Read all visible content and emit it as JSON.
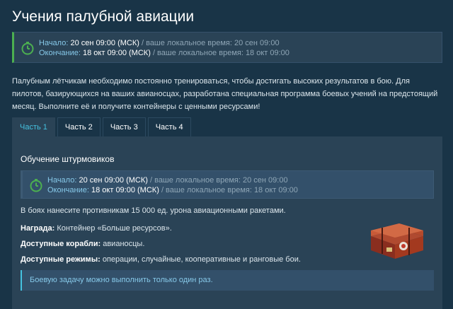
{
  "page_title": "Учения палубной авиации",
  "event_time": {
    "start_label": "Начало:",
    "start_value": "20 сен 09:00 (МСК)",
    "start_local": "/ ваше локальное время: 20 сен 09:00",
    "end_label": "Окончание:",
    "end_value": "18 окт 09:00 (МСК)",
    "end_local": "/ ваше локальное время: 18 окт 09:00"
  },
  "description": "Палубным лётчикам необходимо постоянно тренироваться, чтобы достигать высоких результатов в бою. Для пилотов, базирующихся на ваших авианосцах, разработана специальная программа боевых учений на предстоящий месяц. Выполните её и получите контейнеры с ценными ресурсами!",
  "tabs": [
    {
      "label": "Часть 1",
      "active": true
    },
    {
      "label": "Часть 2",
      "active": false
    },
    {
      "label": "Часть 3",
      "active": false
    },
    {
      "label": "Часть 4",
      "active": false
    }
  ],
  "part": {
    "title": "Обучение штурмовиков",
    "time": {
      "start_label": "Начало:",
      "start_value": "20 сен 09:00 (МСК)",
      "start_local": "/ ваше локальное время: 20 сен 09:00",
      "end_label": "Окончание:",
      "end_value": "18 окт 09:00 (МСК)",
      "end_local": "/ ваше локальное время: 18 окт 09:00"
    },
    "task": "В боях нанесите противникам 15 000 ед. урона авиационными ракетами.",
    "reward_label": "Награда:",
    "reward_value": "Контейнер «Больше ресурсов».",
    "ships_label": "Доступные корабли:",
    "ships_value": "авианосцы.",
    "modes_label": "Доступные режимы:",
    "modes_value": "операции, случайные, кооперативные и ранговые бои.",
    "note": "Боевую задачу можно выполнить только один раз."
  },
  "colors": {
    "background": "#193447",
    "panel": "#2a4356",
    "accent": "#45c2e0",
    "time_border": "#4caf50"
  },
  "icons": {
    "clock": "stopwatch-icon",
    "reward": "container-chest-icon"
  }
}
